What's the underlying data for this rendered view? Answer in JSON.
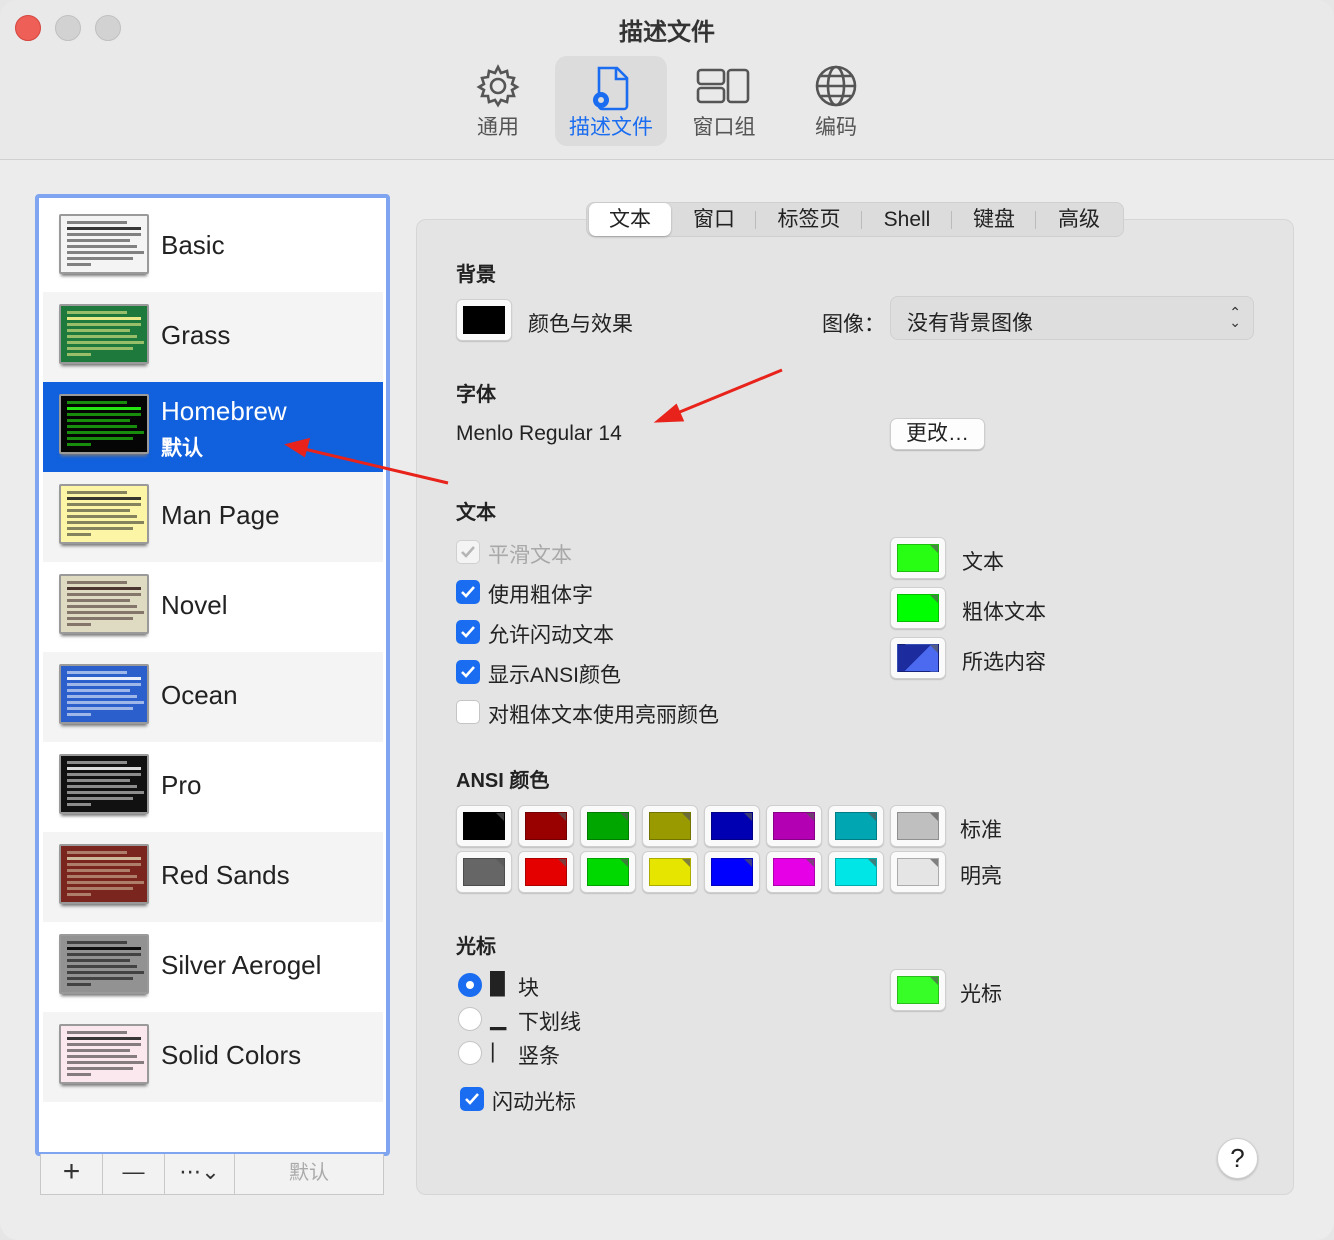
{
  "window": {
    "title": "描述文件"
  },
  "toolbar": {
    "items": [
      {
        "label": "通用",
        "icon": "gear-icon"
      },
      {
        "label": "描述文件",
        "icon": "profile-document-icon",
        "active": true
      },
      {
        "label": "窗口组",
        "icon": "window-group-icon"
      },
      {
        "label": "编码",
        "icon": "globe-icon"
      }
    ]
  },
  "profiles": {
    "items": [
      {
        "name": "Basic",
        "bg": "#f4f4f4",
        "fg": "#222222"
      },
      {
        "name": "Grass",
        "bg": "#1d7a3c",
        "fg": "#fff68f"
      },
      {
        "name": "Homebrew",
        "bg": "#050505",
        "fg": "#28fe14",
        "default_label": "默认",
        "selected": true
      },
      {
        "name": "Man Page",
        "bg": "#fdf5a6",
        "fg": "#222222"
      },
      {
        "name": "Novel",
        "bg": "#dfdbc3",
        "fg": "#3b2322"
      },
      {
        "name": "Ocean",
        "bg": "#2b5fcc",
        "fg": "#ffffff"
      },
      {
        "name": "Pro",
        "bg": "#111111",
        "fg": "#f2f2f2"
      },
      {
        "name": "Red Sands",
        "bg": "#7a251e",
        "fg": "#d7c9a7"
      },
      {
        "name": "Silver Aerogel",
        "bg": "#929292",
        "fg": "#000000"
      },
      {
        "name": "Solid Colors",
        "bg": "#fbe8ef",
        "fg": "#222222"
      }
    ],
    "buttons": {
      "add": "+",
      "remove": "—",
      "more": "⋯⌄",
      "default": "默认"
    }
  },
  "tabs": [
    "文本",
    "窗口",
    "标签页",
    "Shell",
    "键盘",
    "高级"
  ],
  "text_tab": {
    "background": {
      "heading": "背景",
      "color_effects": "颜色与效果",
      "color_effects_swatch": "#000000",
      "image_label": "图像：",
      "image_value": "没有背景图像"
    },
    "font": {
      "heading": "字体",
      "value": "Menlo Regular 14",
      "change_button": "更改…"
    },
    "text": {
      "heading": "文本",
      "options": [
        {
          "label": "平滑文本",
          "checked": true,
          "disabled": true
        },
        {
          "label": "使用粗体字",
          "checked": true
        },
        {
          "label": "允许闪动文本",
          "checked": true
        },
        {
          "label": "显示ANSI颜色",
          "checked": true
        },
        {
          "label": "对粗体文本使用亮丽颜色",
          "checked": false
        }
      ],
      "colors": [
        {
          "label": "文本",
          "color": "#28fe14"
        },
        {
          "label": "粗体文本",
          "color": "#00ff00"
        },
        {
          "label": "所选内容",
          "color": "#1c2b9e"
        }
      ]
    },
    "ansi": {
      "heading": "ANSI 颜色",
      "standard_label": "标准",
      "bright_label": "明亮",
      "standard": [
        "#000000",
        "#990000",
        "#00a600",
        "#999900",
        "#0000b2",
        "#b200b2",
        "#00a6b2",
        "#bfbfbf"
      ],
      "bright": [
        "#666666",
        "#e50000",
        "#00d900",
        "#e5e500",
        "#0000ff",
        "#e500e5",
        "#00e5e5",
        "#e5e5e5"
      ]
    },
    "cursor": {
      "heading": "光标",
      "options": [
        {
          "label": "块",
          "glyph": "█",
          "checked": true
        },
        {
          "label": "下划线",
          "glyph": "▁",
          "checked": false
        },
        {
          "label": "竖条",
          "glyph": "|",
          "checked": false
        }
      ],
      "blink_label": "闪动光标",
      "blink_checked": true,
      "color_label": "光标",
      "color": "#38fe27"
    }
  },
  "help": "?"
}
